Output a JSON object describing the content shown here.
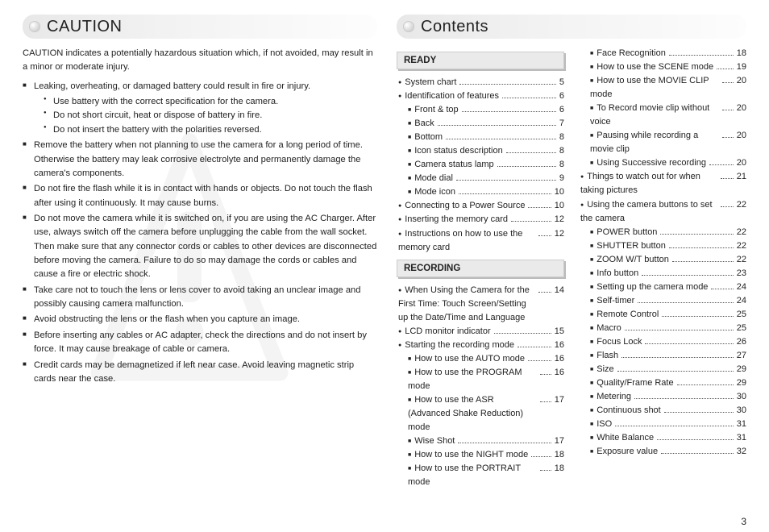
{
  "left": {
    "title": "CAUTION",
    "desc": "CAUTION indicates a potentially hazardous situation which, if not avoided, may result in a minor or moderate injury.",
    "items": [
      {
        "text": "Leaking, overheating, or damaged battery could result in fire or injury.",
        "sub": [
          "Use battery with the correct specification for the camera.",
          "Do not short circuit, heat or dispose of battery in fire.",
          "Do not insert the battery with the polarities reversed."
        ]
      },
      {
        "text": "Remove the battery when not planning to use the camera for a long period of time. Otherwise the battery may leak corrosive electrolyte and permanently damage the camera's components."
      },
      {
        "text": "Do not fire the flash while it is in contact with hands or objects. Do not touch the flash after using it continuously. It may cause burns."
      },
      {
        "text": "Do not move the camera while it is switched on, if you are using the AC Charger. After use, always switch off the camera before unplugging the cable from the wall socket. Then make sure that any connector cords or cables to other devices are disconnected before moving the camera. Failure to do so may damage the cords or cables and cause a fire or electric shock."
      },
      {
        "text": "Take care not to touch the lens or lens cover to avoid taking an unclear image and possibly causing camera malfunction."
      },
      {
        "text": "Avoid obstructing the lens or the flash when you capture an image."
      },
      {
        "text": "Before inserting any cables or AC adapter, check the directions and do not insert by force. It may cause breakage of cable or camera."
      },
      {
        "text": "Credit cards may be demagnetized if left near case. Avoid leaving magnetic strip cards near the case."
      }
    ]
  },
  "right": {
    "title": "Contents",
    "col1": [
      {
        "type": "header",
        "label": "READY"
      },
      {
        "indent": 0,
        "bullet": "circle",
        "label": "System chart",
        "page": "5"
      },
      {
        "indent": 0,
        "bullet": "circle",
        "label": "Identification of features",
        "page": "6"
      },
      {
        "indent": 1,
        "bullet": "square",
        "label": "Front & top",
        "page": "6"
      },
      {
        "indent": 1,
        "bullet": "square",
        "label": "Back",
        "page": "7"
      },
      {
        "indent": 1,
        "bullet": "square",
        "label": "Bottom",
        "page": "8"
      },
      {
        "indent": 1,
        "bullet": "square",
        "label": "Icon status description",
        "page": "8"
      },
      {
        "indent": 1,
        "bullet": "square",
        "label": "Camera status lamp",
        "page": "8"
      },
      {
        "indent": 1,
        "bullet": "square",
        "label": "Mode dial",
        "page": "9"
      },
      {
        "indent": 1,
        "bullet": "square",
        "label": "Mode icon",
        "page": "10"
      },
      {
        "indent": 0,
        "bullet": "circle",
        "label": "Connecting to a Power Source",
        "page": "10"
      },
      {
        "indent": 0,
        "bullet": "circle",
        "label": "Inserting the memory card",
        "page": "12"
      },
      {
        "indent": 0,
        "bullet": "circle",
        "label": "Instructions on how to use the memory card",
        "page": "12",
        "wrap": true
      },
      {
        "type": "header",
        "label": "RECORDING"
      },
      {
        "indent": 0,
        "bullet": "circle",
        "label": "When Using the Camera for the First Time: Touch Screen/Setting up the Date/Time and Language",
        "page": "14",
        "wrap": true
      },
      {
        "indent": 0,
        "bullet": "circle",
        "label": "LCD monitor indicator",
        "page": "15"
      },
      {
        "indent": 0,
        "bullet": "circle",
        "label": "Starting the recording mode",
        "page": "16"
      },
      {
        "indent": 1,
        "bullet": "square",
        "label": "How to use the AUTO mode",
        "page": "16"
      },
      {
        "indent": 1,
        "bullet": "square",
        "label": "How to use the PROGRAM mode",
        "page": "16",
        "wrap": true
      },
      {
        "indent": 1,
        "bullet": "square",
        "label": "How to use the ASR (Advanced Shake Reduction) mode",
        "page": "17",
        "wrap": true
      },
      {
        "indent": 1,
        "bullet": "square",
        "label": "Wise Shot",
        "page": "17"
      },
      {
        "indent": 1,
        "bullet": "square",
        "label": "How to use the NIGHT mode",
        "page": "18"
      },
      {
        "indent": 1,
        "bullet": "square",
        "label": "How to use the PORTRAIT mode",
        "page": "18",
        "wrap": true
      }
    ],
    "col2": [
      {
        "indent": 1,
        "bullet": "square",
        "label": "Face Recognition",
        "page": "18"
      },
      {
        "indent": 1,
        "bullet": "square",
        "label": "How to use the SCENE mode",
        "page": "19",
        "wrap": true
      },
      {
        "indent": 1,
        "bullet": "square",
        "label": "How to use the MOVIE CLIP mode",
        "page": "20",
        "wrap": true
      },
      {
        "indent": 1,
        "bullet": "square",
        "label": "To Record movie clip without voice",
        "page": "20",
        "wrap": true
      },
      {
        "indent": 1,
        "bullet": "square",
        "label": "Pausing while recording a movie clip",
        "page": "20",
        "wrap": true
      },
      {
        "indent": 1,
        "bullet": "square",
        "label": "Using Successive recording",
        "page": "20"
      },
      {
        "indent": 0,
        "bullet": "circle",
        "label": "Things to watch out for when taking pictures",
        "page": "21",
        "wrap": true
      },
      {
        "indent": 0,
        "bullet": "circle",
        "label": "Using the camera buttons to set the camera",
        "page": "22",
        "wrap": true
      },
      {
        "indent": 1,
        "bullet": "square",
        "label": "POWER button",
        "page": "22"
      },
      {
        "indent": 1,
        "bullet": "square",
        "label": "SHUTTER button",
        "page": "22"
      },
      {
        "indent": 1,
        "bullet": "square",
        "label": "ZOOM W/T button",
        "page": "22"
      },
      {
        "indent": 1,
        "bullet": "square",
        "label": "Info button",
        "page": "23"
      },
      {
        "indent": 1,
        "bullet": "square",
        "label": "Setting up the camera mode",
        "page": "24",
        "wrap": true
      },
      {
        "indent": 1,
        "bullet": "square",
        "label": "Self-timer",
        "page": "24"
      },
      {
        "indent": 1,
        "bullet": "square",
        "label": "Remote Control",
        "page": "25"
      },
      {
        "indent": 1,
        "bullet": "square",
        "label": "Macro",
        "page": "25"
      },
      {
        "indent": 1,
        "bullet": "square",
        "label": "Focus Lock",
        "page": "26"
      },
      {
        "indent": 1,
        "bullet": "square",
        "label": "Flash",
        "page": "27"
      },
      {
        "indent": 1,
        "bullet": "square",
        "label": "Size",
        "page": "29"
      },
      {
        "indent": 1,
        "bullet": "square",
        "label": "Quality/Frame Rate",
        "page": "29"
      },
      {
        "indent": 1,
        "bullet": "square",
        "label": "Metering",
        "page": "30"
      },
      {
        "indent": 1,
        "bullet": "square",
        "label": "Continuous shot",
        "page": "30"
      },
      {
        "indent": 1,
        "bullet": "square",
        "label": "ISO",
        "page": "31"
      },
      {
        "indent": 1,
        "bullet": "square",
        "label": "White Balance",
        "page": "31"
      },
      {
        "indent": 1,
        "bullet": "square",
        "label": "Exposure value",
        "page": "32"
      }
    ]
  },
  "pageNumber": "3"
}
